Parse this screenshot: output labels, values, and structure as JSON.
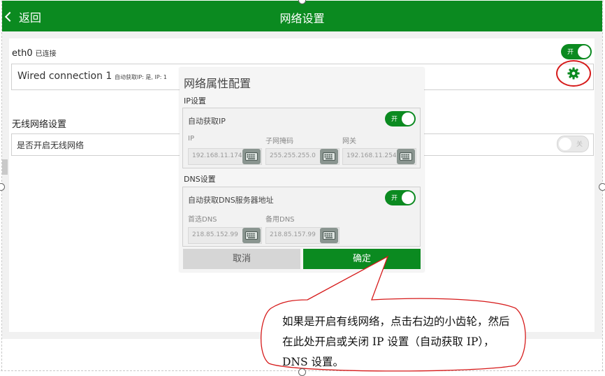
{
  "header": {
    "back_label": "返回",
    "title": "网络设置"
  },
  "eth": {
    "name": "eth0",
    "status": "已连接",
    "toggle_label": "开",
    "connection_name": "Wired connection 1",
    "connection_meta": "自动获取IP: 是, IP: 1"
  },
  "wifi": {
    "section_title": "无线网络设置",
    "enable_label": "是否开启无线网络",
    "toggle_label": "关"
  },
  "dialog": {
    "title": "网络属性配置",
    "ip_section": "IP设置",
    "auto_ip_label": "自动获取IP",
    "auto_ip_toggle": "开",
    "ip_label": "IP",
    "ip_value": "192.168.11.174",
    "mask_label": "子网掩码",
    "mask_value": "255.255.255.0",
    "gateway_label": "网关",
    "gateway_value": "192.168.11.254",
    "dns_section": "DNS设置",
    "auto_dns_label": "自动获取DNS服务器地址",
    "auto_dns_toggle": "开",
    "dns1_label": "首选DNS",
    "dns1_value": "218.85.152.99",
    "dns2_label": "备用DNS",
    "dns2_value": "218.85.157.99",
    "cancel_label": "取消",
    "ok_label": "确定"
  },
  "callout": {
    "text": "如果是开启有线网络，点击右边的小齿轮，然后在此处开启或关闭 IP 设置（自动获取 IP），DNS 设置。"
  },
  "colors": {
    "accent": "#0b8a20",
    "annotation": "#d61a1a"
  }
}
